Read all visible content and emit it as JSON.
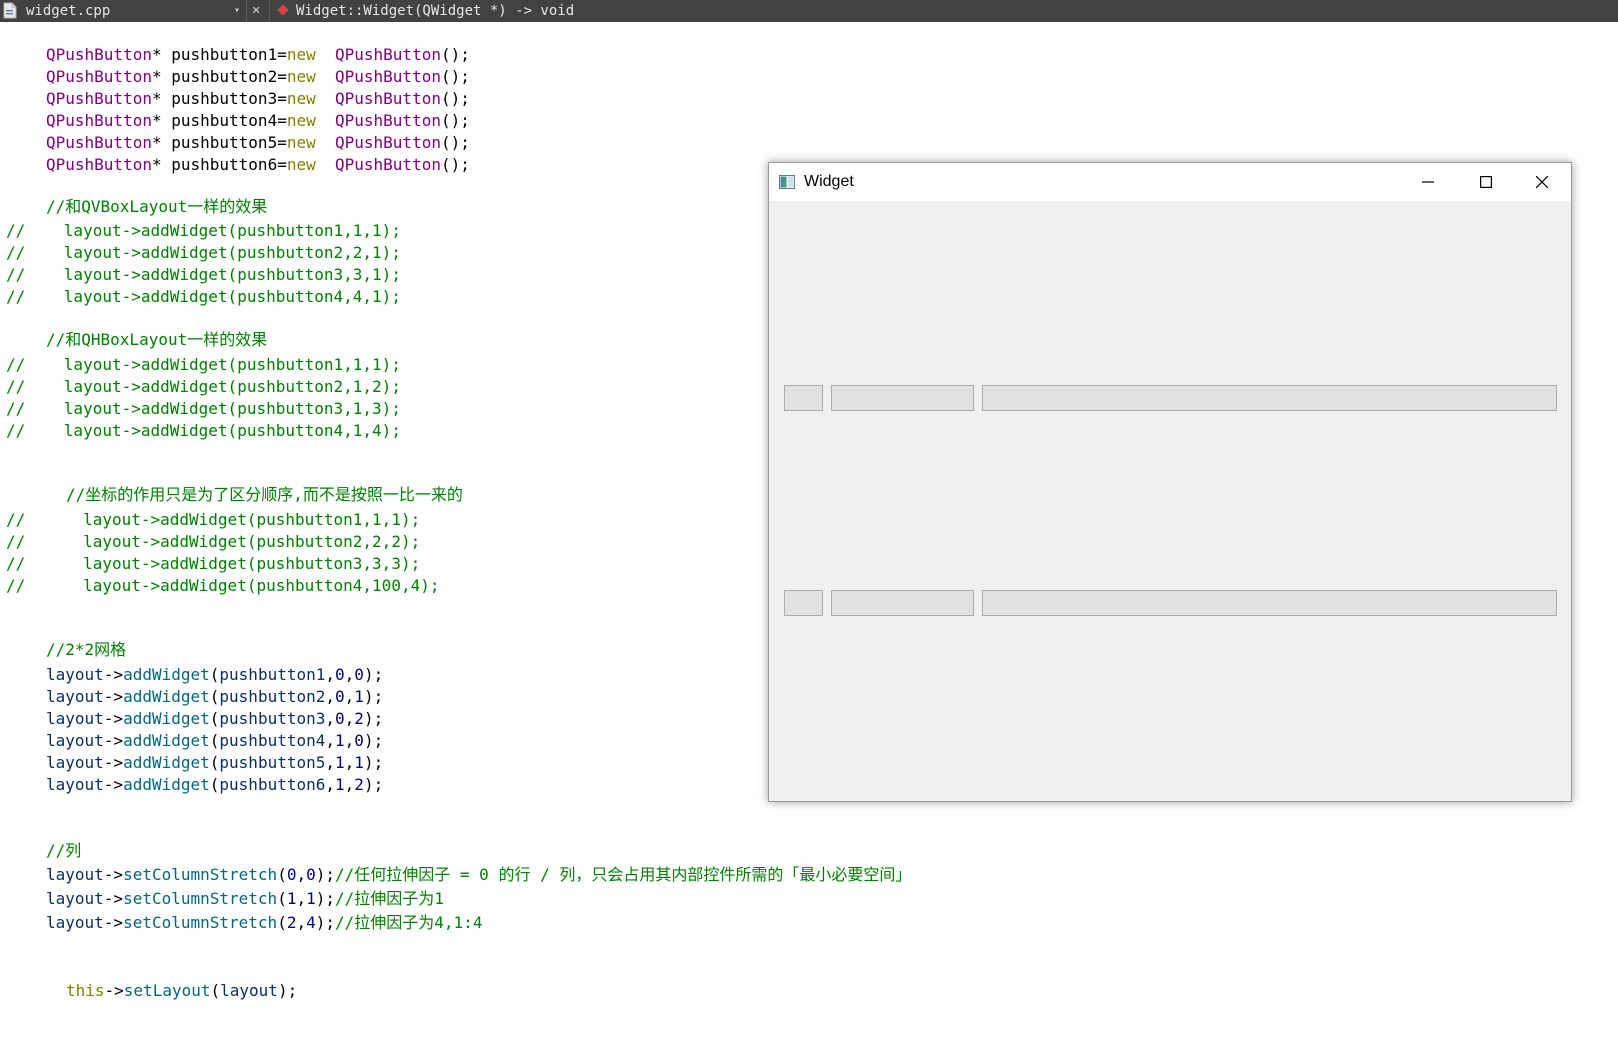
{
  "topbar": {
    "file_name": "widget.cpp",
    "dropdown_glyph": "▾",
    "close_glyph": "✕",
    "symbol": "Widget::Widget(QWidget *) -> void",
    "file_icon": "cpp-file-icon",
    "symbol_icon": "function-symbol-icon"
  },
  "code": {
    "l1": [
      "QPushButton",
      "* pushbutton1=",
      "new",
      "  ",
      "QPushButton",
      "();"
    ],
    "l2": [
      "QPushButton",
      "* pushbutton2=",
      "new",
      "  ",
      "QPushButton",
      "();"
    ],
    "l3": [
      "QPushButton",
      "* pushbutton3=",
      "new",
      "  ",
      "QPushButton",
      "();"
    ],
    "l4": [
      "QPushButton",
      "* pushbutton4=",
      "new",
      "  ",
      "QPushButton",
      "();"
    ],
    "l5": [
      "QPushButton",
      "* pushbutton5=",
      "new",
      "  ",
      "QPushButton",
      "();"
    ],
    "l6": [
      "QPushButton",
      "* pushbutton6=",
      "new",
      "  ",
      "QPushButton",
      "();"
    ],
    "c1": "//和QVBoxLayout一样的效果",
    "v1": "//    layout->addWidget(pushbutton1,1,1);",
    "v2": "//    layout->addWidget(pushbutton2,2,1);",
    "v3": "//    layout->addWidget(pushbutton3,3,1);",
    "v4": "//    layout->addWidget(pushbutton4,4,1);",
    "c2": "//和QHBoxLayout一样的效果",
    "h1": "//    layout->addWidget(pushbutton1,1,1);",
    "h2": "//    layout->addWidget(pushbutton2,1,2);",
    "h3": "//    layout->addWidget(pushbutton3,1,3);",
    "h4": "//    layout->addWidget(pushbutton4,1,4);",
    "c3": "//坐标的作用只是为了区分顺序,而不是按照一比一来的",
    "o1": "//      layout->addWidget(pushbutton1,1,1);",
    "o2": "//      layout->addWidget(pushbutton2,2,2);",
    "o3": "//      layout->addWidget(pushbutton3,3,3);",
    "o4": "//      layout->addWidget(pushbutton4,100,4);",
    "c4": "//2*2网格",
    "g1": [
      "layout",
      "->",
      "addWidget",
      "(",
      "pushbutton1",
      ",",
      "0",
      ",",
      "0",
      ");"
    ],
    "g2": [
      "layout",
      "->",
      "addWidget",
      "(",
      "pushbutton2",
      ",",
      "0",
      ",",
      "1",
      ");"
    ],
    "g3": [
      "layout",
      "->",
      "addWidget",
      "(",
      "pushbutton3",
      ",",
      "0",
      ",",
      "2",
      ");"
    ],
    "g4": [
      "layout",
      "->",
      "addWidget",
      "(",
      "pushbutton4",
      ",",
      "1",
      ",",
      "0",
      ");"
    ],
    "g5": [
      "layout",
      "->",
      "addWidget",
      "(",
      "pushbutton5",
      ",",
      "1",
      ",",
      "1",
      ");"
    ],
    "g6": [
      "layout",
      "->",
      "addWidget",
      "(",
      "pushbutton6",
      ",",
      "1",
      ",",
      "2",
      ");"
    ],
    "c5": "//列",
    "s1": [
      "layout",
      "->",
      "setColumnStretch",
      "(",
      "0",
      ",",
      "0",
      ");",
      "//任何拉伸因子 = 0 的行 / 列，只会占用其内部控件所需的「最小必要空间」"
    ],
    "s2": [
      "layout",
      "->",
      "setColumnStretch",
      "(",
      "1",
      ",",
      "1",
      ");",
      "//拉伸因子为1"
    ],
    "s3": [
      "layout",
      "->",
      "setColumnStretch",
      "(",
      "2",
      ",",
      "4",
      ");",
      "//拉伸因子为4,1:4"
    ],
    "t1": [
      "this",
      "->",
      "setLayout",
      "(",
      "layout",
      ");"
    ]
  },
  "window": {
    "title": "Widget",
    "app_icon": "qt-window-icon",
    "minimize_icon": "minimize-icon",
    "maximize_icon": "maximize-icon",
    "close_icon": "close-icon"
  },
  "colors": {
    "type": "#800080",
    "keyword": "#808000",
    "comment": "#008000",
    "function": "#00677c",
    "number": "#000080",
    "member": "#092e64",
    "topbar": "#404244"
  }
}
